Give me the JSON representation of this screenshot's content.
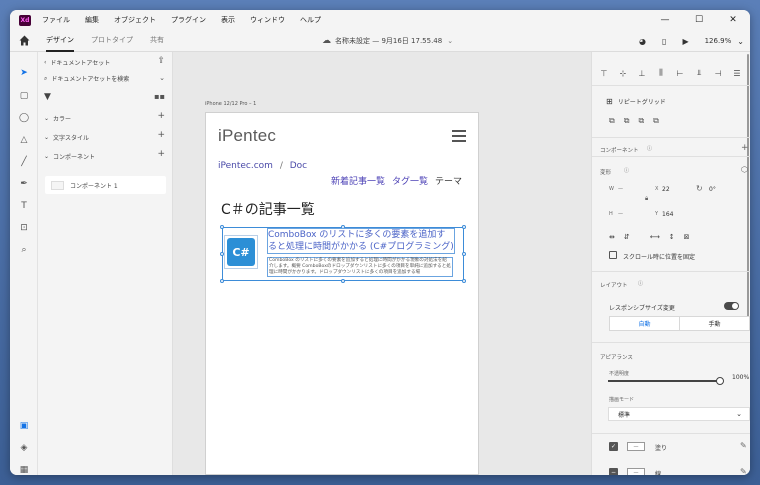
{
  "app": {
    "icon_label": "Xd"
  },
  "menu": [
    "ファイル",
    "編集",
    "オブジェクト",
    "プラグイン",
    "表示",
    "ウィンドウ",
    "ヘルプ"
  ],
  "window_controls": {
    "minimize": "—",
    "maximize": "☐",
    "close": "✕"
  },
  "toolbar": {
    "tabs": [
      "デザイン",
      "プロトタイプ",
      "共有"
    ],
    "active_tab": "デザイン",
    "doc_title": "名称未設定 — 9月16日 17.55.48",
    "zoom": "126.9%"
  },
  "assets": {
    "header": "ドキュメントアセット",
    "search_placeholder": "ドキュメントアセットを検索",
    "sections": [
      "カラー",
      "文字スタイル",
      "コンポーネント"
    ],
    "component_item": "コンポーネント 1"
  },
  "canvas": {
    "artboard_label": "iPhone 12/12 Pro – 1",
    "logo": "iPentec",
    "breadcrumb": [
      "iPentec.com",
      "Doc"
    ],
    "breadcrumb_sep": "/",
    "nav_links": [
      "新着記事一覧",
      "タグ一覧",
      "テーマ"
    ],
    "heading": "C＃の記事一覧",
    "card": {
      "thumb_text": "C#",
      "title": "ComboBox のリストに多くの要素を追加すると処理に時間がかかる (C#プログラミング)",
      "description": "ComboBox のリストに多くの要素を追加すると処理に時間がかかる現象の対処法を紹介します。概要 ComboBoxのドロップダウンリストに多くの項目を単純に追加すると処理に時間がかかります。ドロップダウンリストに多くの項目を追加する場"
    }
  },
  "props": {
    "repeat_grid": "リピートグリッド",
    "component": "コンポーネント",
    "transform": "変形",
    "w_label": "W",
    "w_value": "—",
    "h_label": "H",
    "h_value": "—",
    "x_label": "X",
    "x_value": "22",
    "y_label": "Y",
    "y_value": "164",
    "rotation": "0°",
    "fix_scroll": "スクロール時に位置を固定",
    "layout": "レイアウト",
    "responsive": "レスポンシブサイズ変更",
    "auto": "自動",
    "manual": "手動",
    "appearance": "アピアランス",
    "opacity_label": "不透明度",
    "opacity_value": "100%",
    "blend_label": "描画モード",
    "blend_value": "標準",
    "fill_label": "塗り",
    "stroke_label": "線",
    "swatch_text": "—"
  },
  "colors": {
    "accent": "#1473e6",
    "selection": "#3d8cd8",
    "xd_brand": "#470137",
    "link": "#4b63c7"
  }
}
